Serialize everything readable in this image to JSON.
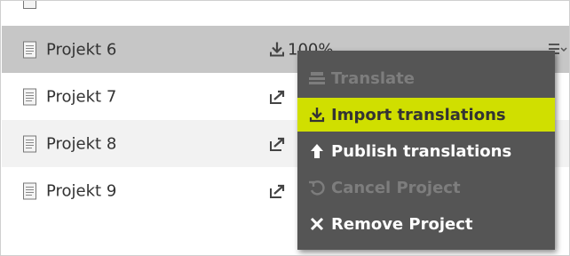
{
  "rows": [
    {
      "name": "Projekt 6",
      "status": "100%",
      "selected": true
    },
    {
      "name": "Projekt 7"
    },
    {
      "name": "Projekt 8"
    },
    {
      "name": "Projekt 9"
    }
  ],
  "menu": {
    "items": [
      {
        "label": "Translate",
        "state": "disabled"
      },
      {
        "label": "Import translations",
        "state": "highlighted"
      },
      {
        "label": "Publish translations",
        "state": "enabled"
      },
      {
        "label": "Cancel Project",
        "state": "disabled"
      },
      {
        "label": "Remove Project",
        "state": "enabled"
      }
    ]
  },
  "colors": {
    "highlight": "#d0df00",
    "menu_bg": "#555555",
    "selected_row": "#c6c6c6",
    "alt_row": "#f2f2f2"
  }
}
